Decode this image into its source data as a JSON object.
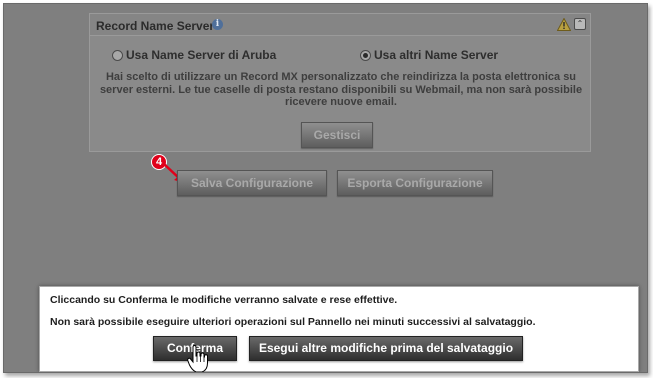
{
  "panel": {
    "title": "Record Name Server",
    "info_icon": "info-icon",
    "warning_icon": "warning-icon",
    "collapse_icon": "collapse-icon",
    "radio_aruba": {
      "label": "Usa Name Server di Aruba",
      "checked": false
    },
    "radio_altri": {
      "label": "Usa altri Name Server",
      "checked": true
    },
    "description": "Hai scelto di utilizzare un Record MX personalizzato che reindirizza la posta elettronica su server esterni. Le tue caselle di posta restano disponibili su Webmail, ma non sarà possibile ricevere nuove email.",
    "gestisci_label": "Gestisci"
  },
  "actions": {
    "step_badge": "4",
    "salva_label": "Salva Configurazione",
    "esporta_label": "Esporta Configurazione"
  },
  "dialog": {
    "line1": "Cliccando su Conferma le modifiche verranno salvate e rese effettive.",
    "line2": "Non sarà possibile eseguire ulteriori operazioni sul Pannello nei minuti successivi al salvataggio.",
    "conferma_label": "Conferma",
    "altre_label": "Esegui altre modifiche prima del salvataggio"
  },
  "colors": {
    "badge": "#e0001a",
    "overlay": "#7f7f7f",
    "dialog_button": "#3a3a3a"
  }
}
